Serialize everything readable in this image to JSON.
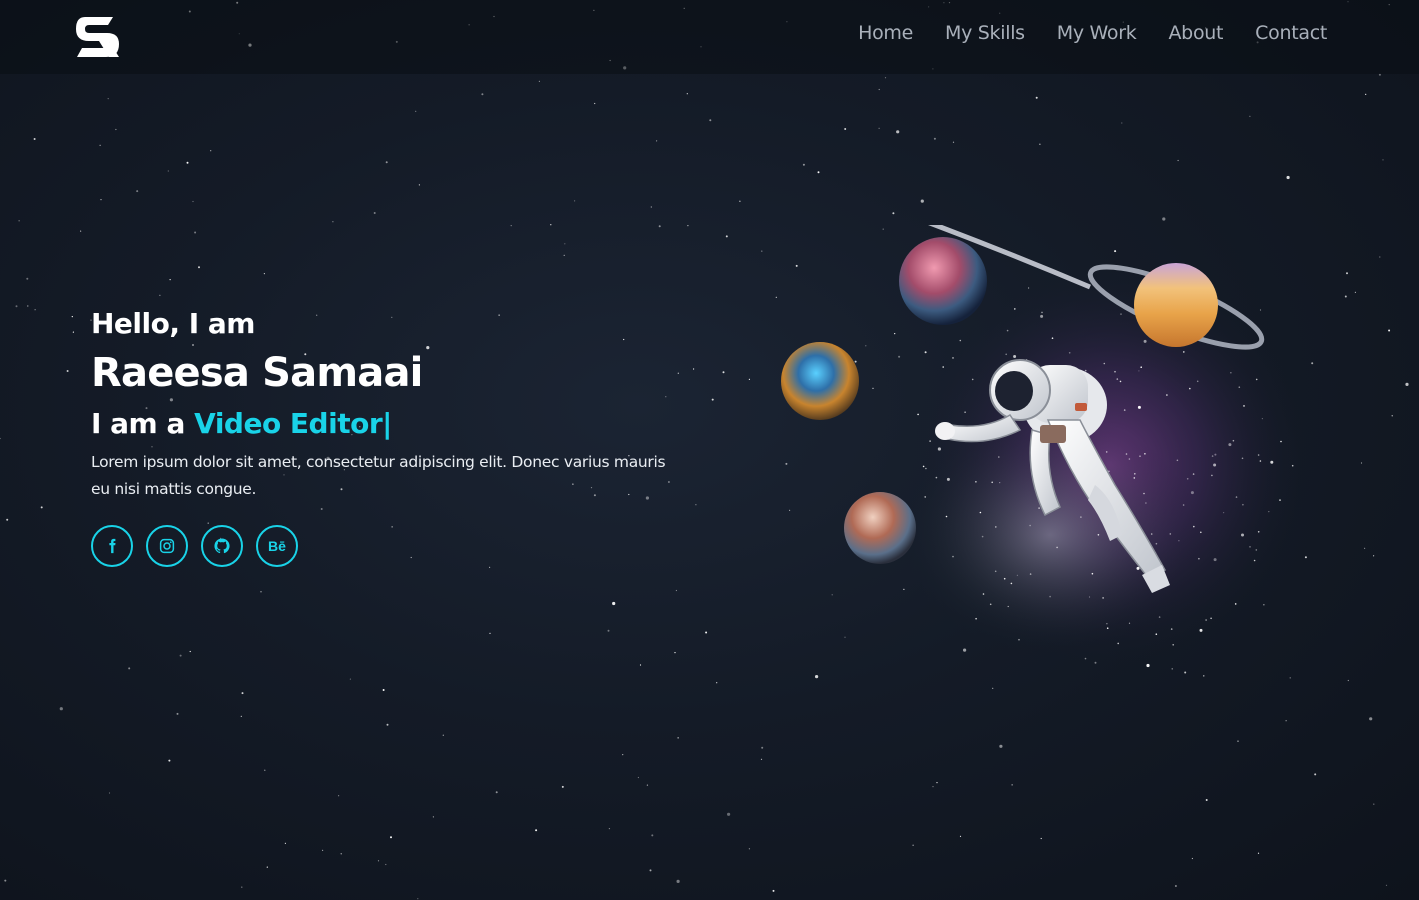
{
  "brand": {
    "logo_icon": "sr-monogram-logo"
  },
  "nav": {
    "items": [
      {
        "label": "Home"
      },
      {
        "label": "My Skills"
      },
      {
        "label": "My Work"
      },
      {
        "label": "About"
      },
      {
        "label": "Contact"
      }
    ]
  },
  "hero": {
    "greeting": "Hello, I am",
    "name": "Raeesa Samaai",
    "role_prefix": "I am a ",
    "role_highlight": "Video Editor",
    "cursor": "|",
    "description": "Lorem ipsum dolor sit amet, consectetur adipiscing elit. Donec varius mauris eu nisi mattis congue."
  },
  "socials": [
    {
      "icon": "facebook-icon"
    },
    {
      "icon": "instagram-icon"
    },
    {
      "icon": "github-icon"
    },
    {
      "icon": "behance-icon",
      "glyph": "Bē"
    }
  ],
  "colors": {
    "accent": "#19d3e8",
    "background": "#141b27",
    "nav_text": "#a9b0ba"
  },
  "illustration": {
    "subject": "astronaut-floating-among-planets"
  }
}
